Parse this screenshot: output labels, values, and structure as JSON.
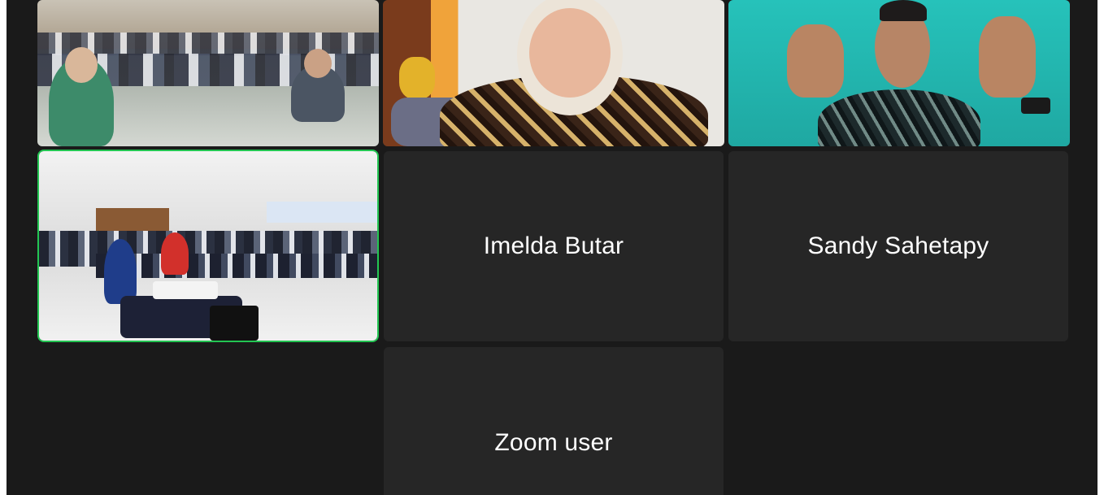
{
  "participants": [
    {
      "id": "video-1",
      "type": "video",
      "description_label": ""
    },
    {
      "id": "video-2",
      "type": "video"
    },
    {
      "id": "video-3",
      "type": "video"
    },
    {
      "id": "video-4",
      "type": "video",
      "active_speaker": true
    },
    {
      "id": "tile-imelda",
      "type": "name",
      "name": "Imelda Butar"
    },
    {
      "id": "tile-sandy",
      "type": "name",
      "name": "Sandy Sahetapy"
    },
    {
      "id": "tile-zoom",
      "type": "name",
      "name": "Zoom user"
    }
  ],
  "tiles": {
    "imelda": {
      "name": "Imelda Butar"
    },
    "sandy": {
      "name": "Sandy Sahetapy"
    },
    "zoom": {
      "name": "Zoom user"
    }
  },
  "colors": {
    "background": "#1a1a1a",
    "tile": "#262626",
    "active_border": "#23c552",
    "name_text": "#ffffff"
  }
}
